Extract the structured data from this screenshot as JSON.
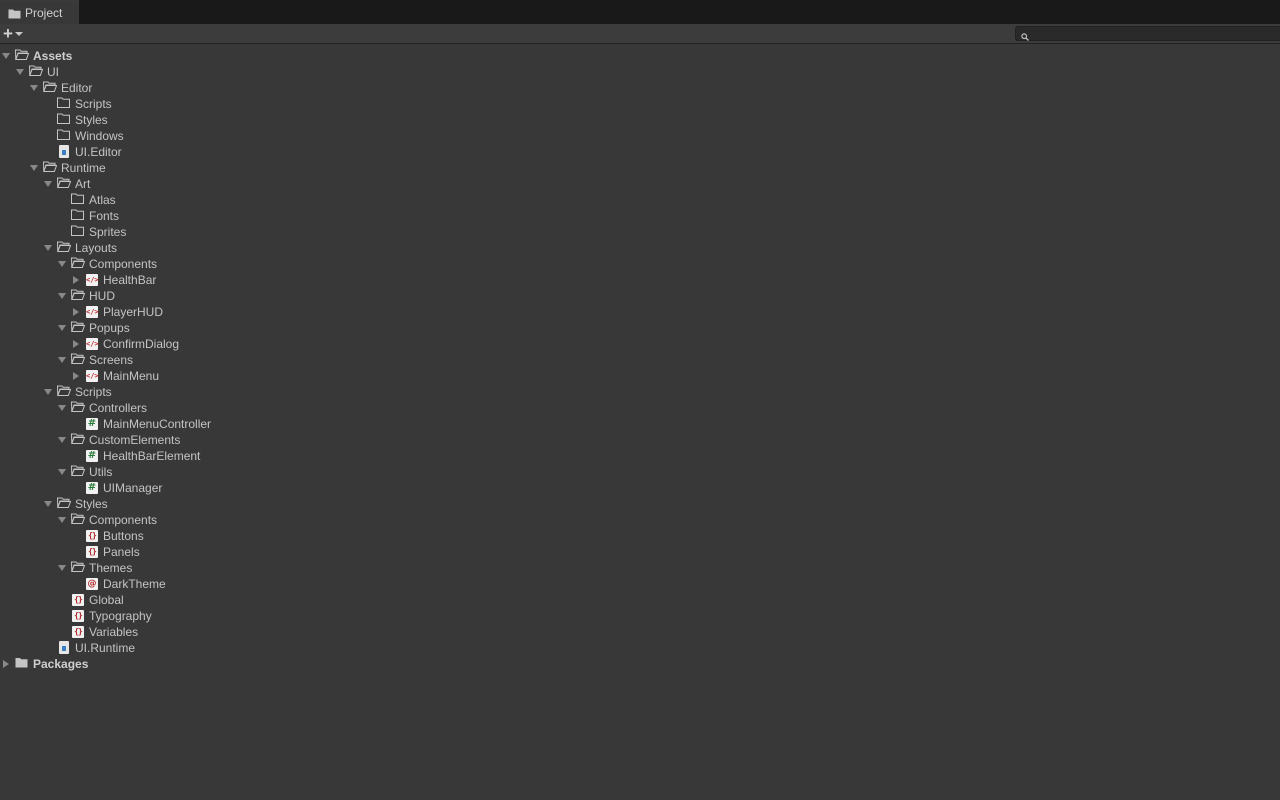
{
  "window": {
    "tab": {
      "label": "Project",
      "icon": "folder-icon"
    }
  },
  "toolbar": {
    "add_label": "+",
    "search": {
      "value": "",
      "placeholder": ""
    }
  },
  "tree": [
    {
      "label": "Assets",
      "depth": 0,
      "arrow": "down",
      "icon": "folder-open",
      "bold": true
    },
    {
      "label": "UI",
      "depth": 1,
      "arrow": "down",
      "icon": "folder-open"
    },
    {
      "label": "Editor",
      "depth": 2,
      "arrow": "down",
      "icon": "folder-open"
    },
    {
      "label": "Scripts",
      "depth": 3,
      "arrow": "none",
      "icon": "folder-empty"
    },
    {
      "label": "Styles",
      "depth": 3,
      "arrow": "none",
      "icon": "folder-empty"
    },
    {
      "label": "Windows",
      "depth": 3,
      "arrow": "none",
      "icon": "folder-empty"
    },
    {
      "label": "UI.Editor",
      "depth": 3,
      "arrow": "none",
      "icon": "asmdef"
    },
    {
      "label": "Runtime",
      "depth": 2,
      "arrow": "down",
      "icon": "folder-open"
    },
    {
      "label": "Art",
      "depth": 3,
      "arrow": "down",
      "icon": "folder-open"
    },
    {
      "label": "Atlas",
      "depth": 4,
      "arrow": "none",
      "icon": "folder-empty"
    },
    {
      "label": "Fonts",
      "depth": 4,
      "arrow": "none",
      "icon": "folder-empty"
    },
    {
      "label": "Sprites",
      "depth": 4,
      "arrow": "none",
      "icon": "folder-empty"
    },
    {
      "label": "Layouts",
      "depth": 3,
      "arrow": "down",
      "icon": "folder-open"
    },
    {
      "label": "Components",
      "depth": 4,
      "arrow": "down",
      "icon": "folder-open"
    },
    {
      "label": "HealthBar",
      "depth": 5,
      "arrow": "right",
      "icon": "uxml"
    },
    {
      "label": "HUD",
      "depth": 4,
      "arrow": "down",
      "icon": "folder-open"
    },
    {
      "label": "PlayerHUD",
      "depth": 5,
      "arrow": "right",
      "icon": "uxml"
    },
    {
      "label": "Popups",
      "depth": 4,
      "arrow": "down",
      "icon": "folder-open"
    },
    {
      "label": "ConfirmDialog",
      "depth": 5,
      "arrow": "right",
      "icon": "uxml"
    },
    {
      "label": "Screens",
      "depth": 4,
      "arrow": "down",
      "icon": "folder-open"
    },
    {
      "label": "MainMenu",
      "depth": 5,
      "arrow": "right",
      "icon": "uxml"
    },
    {
      "label": "Scripts",
      "depth": 3,
      "arrow": "down",
      "icon": "folder-open"
    },
    {
      "label": "Controllers",
      "depth": 4,
      "arrow": "down",
      "icon": "folder-open"
    },
    {
      "label": "MainMenuController",
      "depth": 5,
      "arrow": "none",
      "icon": "csharp"
    },
    {
      "label": "CustomElements",
      "depth": 4,
      "arrow": "down",
      "icon": "folder-open"
    },
    {
      "label": "HealthBarElement",
      "depth": 5,
      "arrow": "none",
      "icon": "csharp"
    },
    {
      "label": "Utils",
      "depth": 4,
      "arrow": "down",
      "icon": "folder-open"
    },
    {
      "label": "UIManager",
      "depth": 5,
      "arrow": "none",
      "icon": "csharp"
    },
    {
      "label": "Styles",
      "depth": 3,
      "arrow": "down",
      "icon": "folder-open"
    },
    {
      "label": "Components",
      "depth": 4,
      "arrow": "down",
      "icon": "folder-open"
    },
    {
      "label": "Buttons",
      "depth": 5,
      "arrow": "none",
      "icon": "uss"
    },
    {
      "label": "Panels",
      "depth": 5,
      "arrow": "none",
      "icon": "uss"
    },
    {
      "label": "Themes",
      "depth": 4,
      "arrow": "down",
      "icon": "folder-open"
    },
    {
      "label": "DarkTheme",
      "depth": 5,
      "arrow": "none",
      "icon": "tss"
    },
    {
      "label": "Global",
      "depth": 4,
      "arrow": "none",
      "icon": "uss"
    },
    {
      "label": "Typography",
      "depth": 4,
      "arrow": "none",
      "icon": "uss"
    },
    {
      "label": "Variables",
      "depth": 4,
      "arrow": "none",
      "icon": "uss"
    },
    {
      "label": "UI.Runtime",
      "depth": 3,
      "arrow": "none",
      "icon": "asmdef"
    },
    {
      "label": "Packages",
      "depth": 0,
      "arrow": "right",
      "icon": "folder-closed",
      "bold": true
    }
  ],
  "glyphs": {
    "uxml": "</>",
    "csharp": "#",
    "uss": "{}",
    "tss": "@"
  },
  "colors": {
    "background": "#383838",
    "tabbar": "#191919",
    "text": "#c4c4c4",
    "folder": "#c4c4c4"
  }
}
